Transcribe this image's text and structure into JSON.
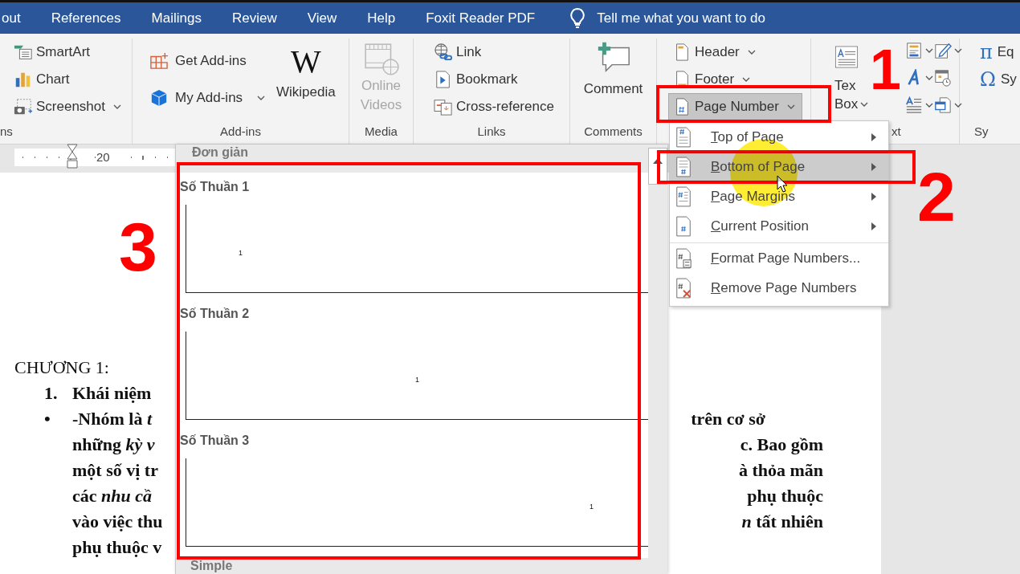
{
  "tabs": [
    {
      "label": "out"
    },
    {
      "label": "References"
    },
    {
      "label": "Mailings"
    },
    {
      "label": "Review"
    },
    {
      "label": "View"
    },
    {
      "label": "Help"
    },
    {
      "label": "Foxit Reader PDF"
    }
  ],
  "tell_me": "Tell me what you want to do",
  "ribbon": {
    "illustrations": {
      "label": "ns",
      "items": [
        {
          "label": "SmartArt",
          "dropdown": false
        },
        {
          "label": "Chart",
          "dropdown": false
        },
        {
          "label": "Screenshot",
          "dropdown": true
        }
      ]
    },
    "addins": {
      "label": "Add-ins",
      "items": [
        {
          "label": "Get Add-ins",
          "dropdown": false
        },
        {
          "label": "My Add-ins",
          "dropdown": true
        }
      ],
      "wikipedia": {
        "logo": "W",
        "label": "Wikipedia"
      }
    },
    "media": {
      "label": "Media",
      "online_videos": {
        "lines": [
          "Online",
          "Videos"
        ],
        "disabled": true
      }
    },
    "links": {
      "label": "Links",
      "items": [
        {
          "label": "Link"
        },
        {
          "label": "Bookmark"
        },
        {
          "label": "Cross-reference"
        }
      ]
    },
    "comments": {
      "label": "Comments",
      "comment": "Comment"
    },
    "header_footer": {
      "items": [
        {
          "label": "Header",
          "dropdown": true,
          "pressed": false
        },
        {
          "label": "Footer",
          "dropdown": true,
          "pressed": false
        },
        {
          "label": "Page Number",
          "dropdown": true,
          "pressed": true
        }
      ]
    },
    "text": {
      "label": "xt",
      "text_box": {
        "lines": [
          "Tex",
          "Box"
        ],
        "dropdown": true
      }
    },
    "symbols": {
      "label": "Sy",
      "items": [
        {
          "symbol": "π",
          "label": "Eq"
        },
        {
          "symbol": "Ω",
          "label": "Sy"
        }
      ]
    }
  },
  "ruler": {
    "labels": [
      "20"
    ]
  },
  "document": {
    "lines": [
      {
        "kind": "heading",
        "left": "CHƯƠNG 1:"
      },
      {
        "kind": "list",
        "marker": "1.",
        "left": "Khái niệm"
      },
      {
        "kind": "list",
        "marker": "•",
        "left": "-Nhóm là *t*",
        "right": "trên cơ sở"
      },
      {
        "kind": "text",
        "left": "những *kỳ v*",
        "right": "c. Bao gồm"
      },
      {
        "kind": "text",
        "left": "một số vị tr",
        "right": "à thỏa mãn"
      },
      {
        "kind": "text",
        "left": "các *nhu cầ*",
        "right": "phụ thuộc"
      },
      {
        "kind": "text",
        "left": "vào việc thu",
        "right": "*n* tất nhiên"
      },
      {
        "kind": "text",
        "left": "phụ thuộc v"
      }
    ]
  },
  "gallery": {
    "header": "Đơn giản",
    "items": [
      {
        "title": "Số Thuần 1",
        "number": "1"
      },
      {
        "title": "Số Thuần 2",
        "number": "1"
      },
      {
        "title": "Số Thuần 3",
        "number": "1"
      }
    ],
    "footer": "Simple"
  },
  "page_number_menu": {
    "items": [
      {
        "kind": "top",
        "label": "Top of Page",
        "submenu": true,
        "selected": false,
        "divider_before": false
      },
      {
        "kind": "bottom",
        "label": "Bottom of Page",
        "submenu": true,
        "selected": true,
        "divider_before": false
      },
      {
        "kind": "margins",
        "label": "Page Margins",
        "submenu": true,
        "selected": false,
        "divider_before": false
      },
      {
        "kind": "current",
        "label": "Current Position",
        "submenu": true,
        "selected": false,
        "divider_before": false
      },
      {
        "kind": "format",
        "label": "Format Page Numbers...",
        "submenu": false,
        "selected": false,
        "divider_before": true
      },
      {
        "kind": "remove",
        "label": "Remove Page Numbers",
        "submenu": false,
        "selected": false,
        "divider_before": false
      }
    ]
  },
  "annotations": [
    {
      "label": "1"
    },
    {
      "label": "2"
    },
    {
      "label": "3"
    }
  ]
}
